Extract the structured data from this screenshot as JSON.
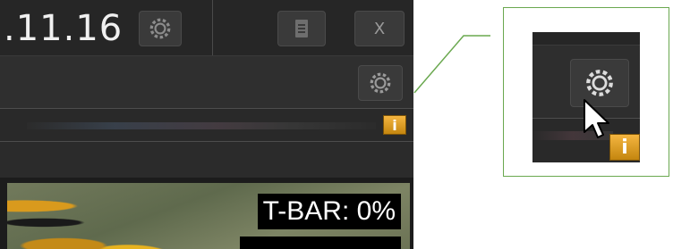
{
  "app": {
    "version_text": ".11.16",
    "close_label": "X",
    "tbar_label": "T-BAR: 0%",
    "info_label": "i"
  },
  "zoom": {
    "info_label": "i"
  },
  "icons": {
    "settings": "gear-icon",
    "document": "document-icon",
    "cursor": "mouse-pointer-icon"
  },
  "colors": {
    "callout_green": "#6aa84f",
    "info_amber": "#e0a020",
    "panel_dark": "#2e2e2e"
  }
}
